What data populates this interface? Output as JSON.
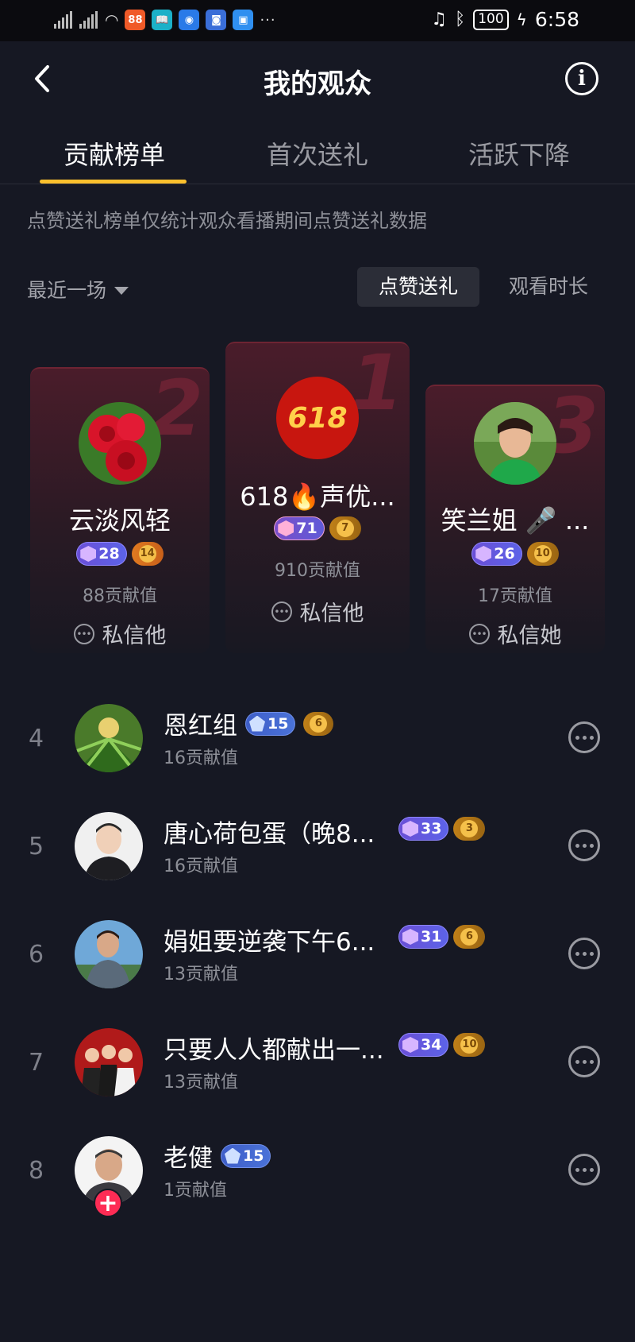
{
  "status_bar": {
    "apps": [
      "88",
      "📖",
      "◉",
      "◙",
      "▣"
    ],
    "dots": "···",
    "battery": "100",
    "time": "6:58"
  },
  "header": {
    "title": "我的观众",
    "info_symbol": "i"
  },
  "tabs": [
    {
      "label": "贡献榜单",
      "active": true
    },
    {
      "label": "首次送礼",
      "active": false
    },
    {
      "label": "活跃下降",
      "active": false
    }
  ],
  "notice": "点赞送礼榜单仅统计观众看播期间点赞送礼数据",
  "filter": {
    "range_label": "最近一场",
    "segment_active": "点赞送礼",
    "segment_inactive": "观看时长"
  },
  "podium": [
    {
      "rank": "2",
      "name": "云淡风轻",
      "level": "28",
      "fan": "14",
      "value": "88贡献值",
      "message": "私信他"
    },
    {
      "rank": "1",
      "name": "618🔥声优...",
      "avatar_text": "618",
      "level": "71",
      "fan": "7",
      "value": "910贡献值",
      "message": "私信他"
    },
    {
      "rank": "3",
      "name": "笑兰姐 🎤 ...",
      "level": "26",
      "fan": "10",
      "value": "17贡献值",
      "message": "私信她"
    }
  ],
  "list": [
    {
      "rank": "4",
      "name": "恩红组",
      "level": "15",
      "fan": "6",
      "value": "16贡献值"
    },
    {
      "rank": "5",
      "name": "唐心荷包蛋（晚8...",
      "level": "33",
      "fan": "3",
      "value": "16贡献值"
    },
    {
      "rank": "6",
      "name": "娟姐要逆袭下午6...",
      "level": "31",
      "fan": "6",
      "value": "13贡献值"
    },
    {
      "rank": "7",
      "name": "只要人人都献出一...",
      "level": "34",
      "fan": "10",
      "value": "13贡献值"
    },
    {
      "rank": "8",
      "name": "老健",
      "level": "15",
      "value": "1贡献值",
      "follow_symbol": "+"
    }
  ],
  "colors": {
    "background": "#161823",
    "accent_underline": "#fbc02d",
    "follow_button": "#fe2c55"
  }
}
